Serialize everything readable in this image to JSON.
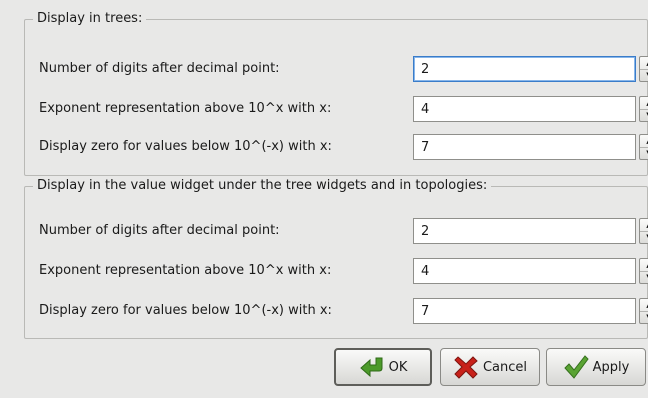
{
  "groups": [
    {
      "title": "Display in trees:",
      "rows": [
        {
          "label": "Number of digits after decimal point:",
          "value": "2"
        },
        {
          "label": "Exponent representation above 10^x with x:",
          "value": "4"
        },
        {
          "label": "Display zero for values below 10^(-x) with x:",
          "value": "7"
        }
      ]
    },
    {
      "title": "Display in the value widget under the tree widgets and in topologies:",
      "rows": [
        {
          "label": "Number of digits after decimal point:",
          "value": "2"
        },
        {
          "label": "Exponent representation above 10^x with x:",
          "value": "4"
        },
        {
          "label": "Display zero for values below 10^(-x) with x:",
          "value": "7"
        }
      ]
    }
  ],
  "buttons": {
    "ok": {
      "label": "OK",
      "icon": "ok-arrow-icon"
    },
    "cancel": {
      "label": "Cancel",
      "icon": "cancel-x-icon"
    },
    "apply": {
      "label": "Apply",
      "icon": "apply-check-icon"
    }
  },
  "colors": {
    "window_bg": "#e8e8e7",
    "focus_border": "#3a7cc9",
    "ok_icon": "#4c9a2a",
    "cancel_icon": "#c8211a",
    "apply_icon": "#5aa333"
  }
}
